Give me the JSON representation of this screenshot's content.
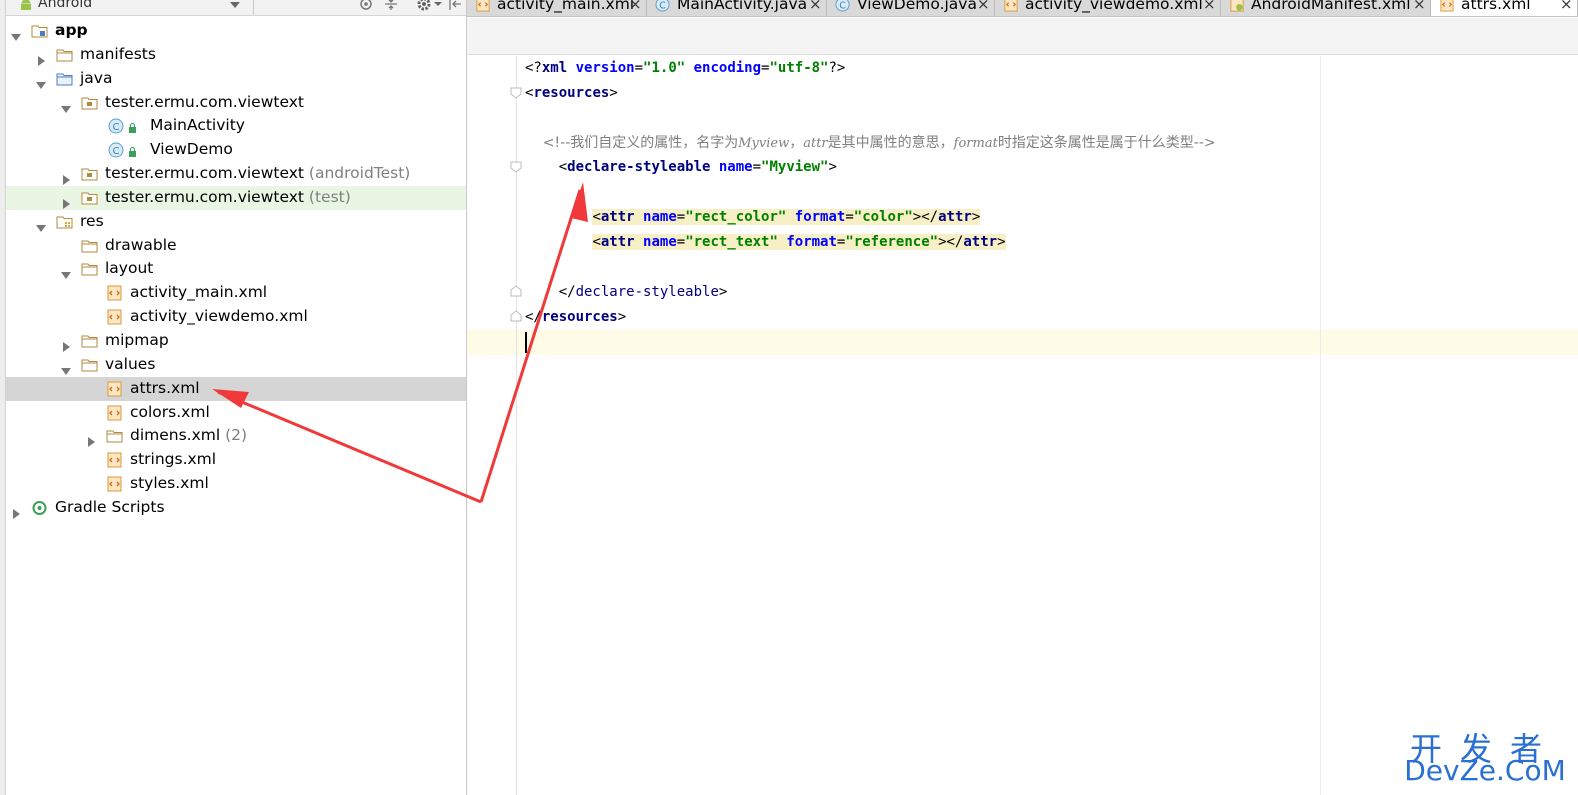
{
  "project_panel": {
    "view_mode": "Android",
    "tree": [
      {
        "label": "app",
        "bold": true,
        "suffix": "",
        "icon": "app-module-icon",
        "arrow": "expanded"
      },
      {
        "label": "manifests",
        "suffix": "",
        "icon": "folder-icon",
        "arrow": "collapsed"
      },
      {
        "label": "java",
        "suffix": "",
        "icon": "source-folder-icon",
        "arrow": "expanded"
      },
      {
        "label": "tester.ermu.com.viewtext",
        "suffix": "",
        "icon": "package-icon",
        "arrow": "expanded"
      },
      {
        "label": "MainActivity",
        "suffix": "",
        "icon": "java-class-icon",
        "arrow": "none"
      },
      {
        "label": "ViewDemo",
        "suffix": "",
        "icon": "java-class-icon",
        "arrow": "none"
      },
      {
        "label": "tester.ermu.com.viewtext",
        "suffix": " (androidTest)",
        "icon": "package-icon",
        "arrow": "collapsed"
      },
      {
        "label": "tester.ermu.com.viewtext",
        "suffix": " (test)",
        "icon": "package-icon",
        "arrow": "collapsed"
      },
      {
        "label": "res",
        "suffix": "",
        "icon": "resource-folder-icon",
        "arrow": "expanded"
      },
      {
        "label": "drawable",
        "suffix": "",
        "icon": "folder-icon",
        "arrow": "none"
      },
      {
        "label": "layout",
        "suffix": "",
        "icon": "folder-icon",
        "arrow": "expanded"
      },
      {
        "label": "activity_main.xml",
        "suffix": "",
        "icon": "xml-file-icon",
        "arrow": "none"
      },
      {
        "label": "activity_viewdemo.xml",
        "suffix": "",
        "icon": "xml-file-icon",
        "arrow": "none"
      },
      {
        "label": "mipmap",
        "suffix": "",
        "icon": "folder-icon",
        "arrow": "collapsed"
      },
      {
        "label": "values",
        "suffix": "",
        "icon": "folder-icon",
        "arrow": "expanded"
      },
      {
        "label": "attrs.xml",
        "suffix": "",
        "icon": "xml-file-icon",
        "arrow": "none",
        "selected": true
      },
      {
        "label": "colors.xml",
        "suffix": "",
        "icon": "xml-file-icon",
        "arrow": "none"
      },
      {
        "label": "dimens.xml",
        "suffix": " (2)",
        "icon": "folder-icon",
        "arrow": "collapsed"
      },
      {
        "label": "strings.xml",
        "suffix": "",
        "icon": "xml-file-icon",
        "arrow": "none"
      },
      {
        "label": "styles.xml",
        "suffix": "",
        "icon": "xml-file-icon",
        "arrow": "none"
      },
      {
        "label": "Gradle Scripts",
        "suffix": "",
        "icon": "gradle-icon",
        "arrow": "collapsed"
      }
    ]
  },
  "tabs": [
    {
      "label": "activity_main.xml",
      "icon": "xml-file-icon",
      "close": "×"
    },
    {
      "label": "MainActivity.java",
      "icon": "java-class-icon",
      "close": "×"
    },
    {
      "label": "ViewDemo.java",
      "icon": "java-class-icon",
      "close": "×"
    },
    {
      "label": "activity_viewdemo.xml",
      "icon": "xml-file-icon",
      "close": "×"
    },
    {
      "label": "AndroidManifest.xml",
      "icon": "manifest-file-icon",
      "close": "×"
    },
    {
      "label": "attrs.xml",
      "icon": "xml-file-icon",
      "close": "×",
      "active": true
    }
  ],
  "editor": {
    "lines": [
      [
        [
          "punc",
          "<?"
        ],
        [
          "tag",
          "xml "
        ],
        [
          "attr",
          "version"
        ],
        [
          "punc",
          "="
        ],
        [
          "val",
          "\"1.0\" "
        ],
        [
          "attr",
          "encoding"
        ],
        [
          "punc",
          "="
        ],
        [
          "val",
          "\"utf-8\""
        ],
        [
          "punc",
          "?>"
        ]
      ],
      [
        [
          "punc",
          "<"
        ],
        [
          "tag",
          "resources"
        ],
        [
          "punc",
          ">"
        ]
      ],
      [],
      [
        [
          "com",
          "    <!--我们自定义的属性，名字为"
        ],
        [
          "comit",
          "Myview"
        ],
        [
          "com",
          "，"
        ],
        [
          "comit",
          "attr"
        ],
        [
          "com",
          "是其中属性的意思，"
        ],
        [
          "comit",
          "format"
        ],
        [
          "com",
          "时指定这条属性是属于什么类型-->"
        ]
      ],
      [
        [
          "punc",
          "    <"
        ],
        [
          "tag",
          "declare-styleable "
        ],
        [
          "attr",
          "name"
        ],
        [
          "punc",
          "="
        ],
        [
          "val",
          "\"Myview\""
        ],
        [
          "punc",
          ">"
        ]
      ],
      [],
      [
        [
          "punc",
          "        "
        ],
        [
          "punc",
          "<",
          "hl"
        ],
        [
          "tag",
          "attr ",
          "hl"
        ],
        [
          "attr",
          "name",
          "hl"
        ],
        [
          "punc",
          "=",
          "hl"
        ],
        [
          "val",
          "\"rect_color\" ",
          "hl"
        ],
        [
          "attr",
          "format",
          "hl"
        ],
        [
          "punc",
          "=",
          "hl"
        ],
        [
          "val",
          "\"color\"",
          "hl"
        ],
        [
          "punc",
          "></",
          "hl"
        ],
        [
          "tag",
          "attr",
          "hl"
        ],
        [
          "punc",
          ">",
          "hl"
        ]
      ],
      [
        [
          "punc",
          "        "
        ],
        [
          "punc",
          "<",
          "hl"
        ],
        [
          "tag",
          "attr ",
          "hl"
        ],
        [
          "attr",
          "name",
          "hl"
        ],
        [
          "punc",
          "=",
          "hl"
        ],
        [
          "val",
          "\"rect_text\" ",
          "hl"
        ],
        [
          "attr",
          "format",
          "hl"
        ],
        [
          "punc",
          "=",
          "hl"
        ],
        [
          "val",
          "\"reference\"",
          "hl"
        ],
        [
          "punc",
          "></",
          "hl"
        ],
        [
          "tag",
          "attr",
          "hl"
        ],
        [
          "punc",
          ">",
          "hl"
        ]
      ],
      [],
      [
        [
          "punc",
          "    </"
        ],
        [
          "tagn",
          "declare-styleable"
        ],
        [
          "punc",
          ">"
        ]
      ],
      [
        [
          "punc",
          "</"
        ],
        [
          "tag",
          "resources"
        ],
        [
          "punc",
          ">"
        ]
      ],
      []
    ]
  },
  "watermark": {
    "cn": "开发者",
    "en": "DevZe.CoM"
  },
  "colors": {
    "annotation_arrow": "#f0393a",
    "watermark": "#2a6fd4",
    "selection": "#d5d5d5",
    "test_source_bg": "#eaf6e4"
  }
}
